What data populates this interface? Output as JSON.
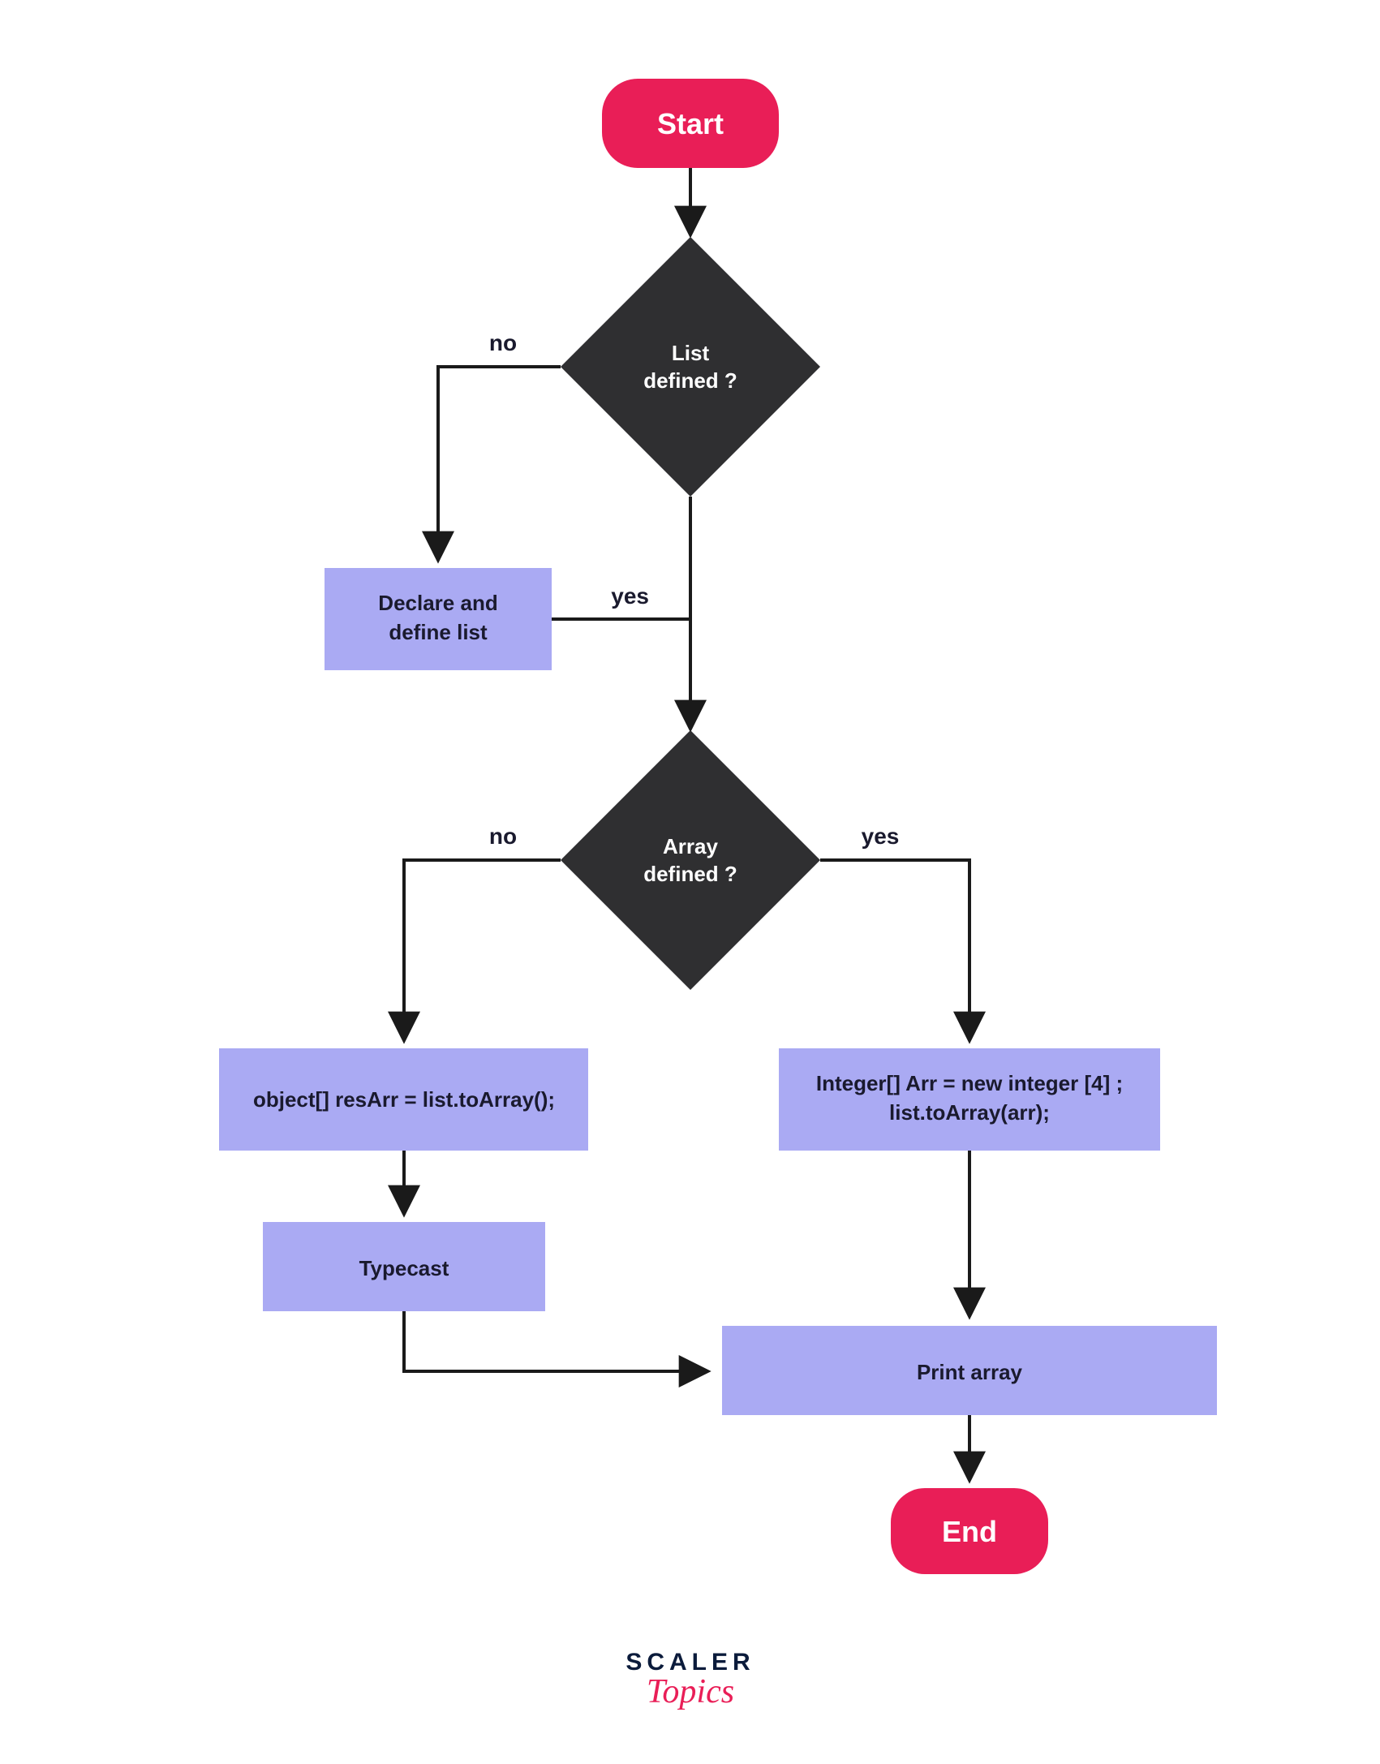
{
  "flow": {
    "start": "Start",
    "end": "End",
    "decision1": {
      "line1": "List",
      "line2": "defined ?",
      "no": "no",
      "yes": "yes"
    },
    "decision2": {
      "line1": "Array",
      "line2": "defined ?",
      "no": "no",
      "yes": "yes"
    },
    "declare": {
      "line1": "Declare and",
      "line2": "define list"
    },
    "codeLeft": "object[] resArr = list.toArray();",
    "typecast": "Typecast",
    "codeRight": {
      "line1": "Integer[] Arr = new integer [4] ;",
      "line2": "list.toArray(arr);"
    },
    "print": "Print array"
  },
  "brand": {
    "line1": "SCALER",
    "line2": "Topics"
  }
}
